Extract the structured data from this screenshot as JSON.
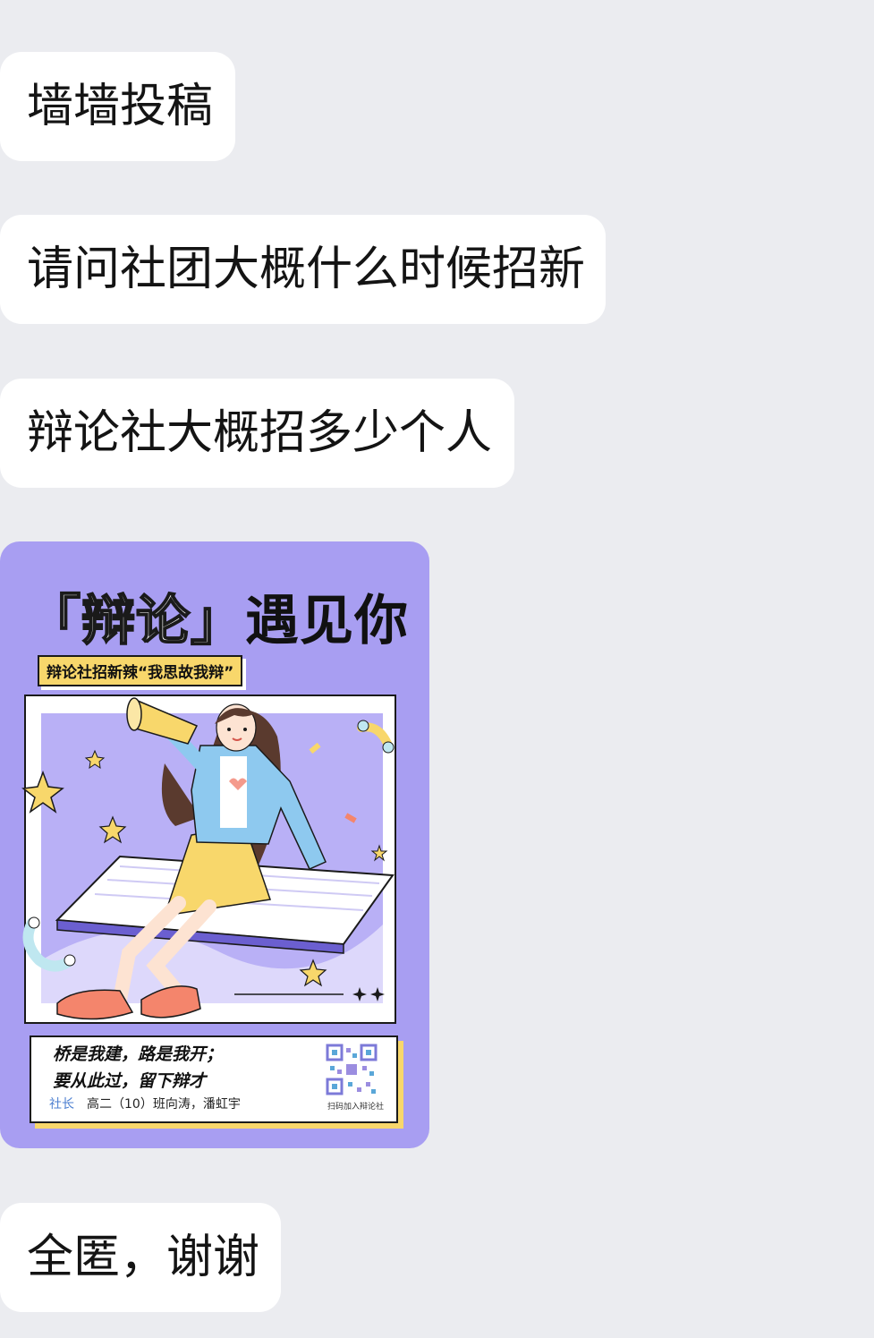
{
  "messages": [
    {
      "id": "msg1",
      "type": "text",
      "text": "墙墙投稿"
    },
    {
      "id": "msg2",
      "type": "text",
      "text": "请问社团大概什么时候招新"
    },
    {
      "id": "msg3",
      "type": "text",
      "text": "辩论社大概招多少个人"
    },
    {
      "id": "msg4",
      "type": "image"
    },
    {
      "id": "msg5",
      "type": "text",
      "text": "全匿，谢谢"
    }
  ],
  "poster": {
    "headline_bracket_open": "「",
    "headline_bracket_word": "辩论",
    "headline_bracket_close": "」",
    "headline_rest": "遇见你",
    "banner": "辩论社招新辣“我思故我辩”",
    "slogan_line1": "桥是我建，路是我开；",
    "slogan_line2": "要从此过，留下辩才",
    "leader_tag": "社长",
    "leader_names": "高二（10）班向涛，潘虹宇",
    "qr_label": "扫码加入辩论社",
    "colors": {
      "background": "#a89ef2",
      "accent_yellow": "#f8d76b",
      "jacket_blue": "#8ec9ef"
    }
  },
  "colors": {
    "chat_background": "#ebecf0",
    "bubble": "#ffffff"
  }
}
